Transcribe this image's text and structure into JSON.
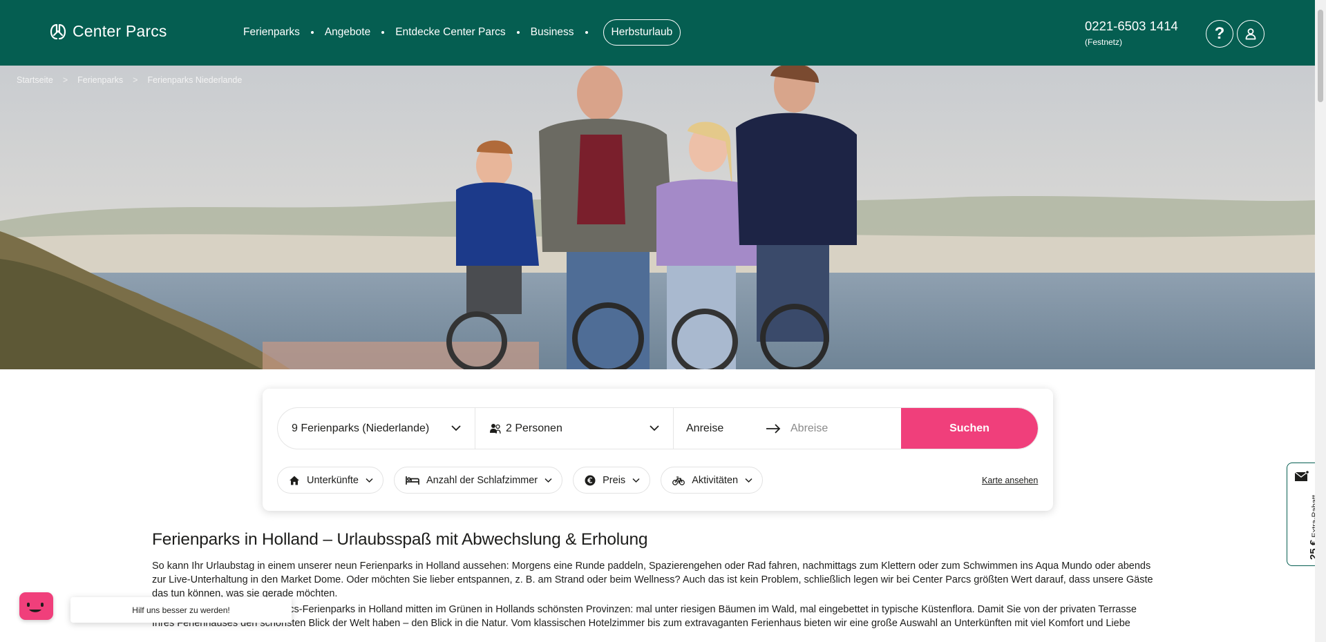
{
  "header": {
    "brand": "Center Parcs",
    "nav": [
      {
        "label": "Ferienparks"
      },
      {
        "label": "Angebote"
      },
      {
        "label": "Entdecke Center Parcs"
      },
      {
        "label": "Business"
      }
    ],
    "highlight_label": "Herbsturlaub",
    "phone": "0221-6503 1414",
    "phone_note": "(Festnetz)",
    "help_label": "?",
    "icons": {
      "help": "question-icon",
      "account": "user-icon"
    }
  },
  "breadcrumb": [
    "Startseite",
    "Ferienparks",
    "Ferienparks Niederlande"
  ],
  "search": {
    "park": "9 Ferienparks (Niederlande)",
    "persons": "2 Personen",
    "arrival": "Anreise",
    "departure": "Abreise",
    "submit": "Suchen"
  },
  "filters": [
    {
      "label": "Unterkünfte",
      "icon": "home-icon"
    },
    {
      "label": "Anzahl der Schlafzimmer",
      "icon": "bed-icon"
    },
    {
      "label": "Preis",
      "icon": "euro-icon"
    },
    {
      "label": "Aktivitäten",
      "icon": "bike-icon"
    }
  ],
  "map_link": "Karte ansehen",
  "content": {
    "title": "Ferienparks in Holland – Urlaubsspaß mit Abwechslung & Erholung",
    "paragraphs": [
      "So kann Ihr Urlaubstag in einem unserer neun Ferienparks in Holland aussehen: Morgens eine Runde paddeln, Spazierengehen oder Rad fahren, nachmittags zum Klettern oder zum Schwimmen ins Aqua Mundo oder abends zur Live-Unterhaltung in den Market Dome. Oder möchten Sie lieber entspannen, z. B. am Strand oder beim Wellness? Auch das ist kein Problem, schließlich legen wir bei Center Parcs größten Wert darauf, dass unsere Gäste das tun können, was sie gerade möchten.",
      "Übrigens liegen die Center Parcs-Ferienparks in Holland mitten im Grünen in Hollands schönsten Provinzen: mal unter riesigen Bäumen im Wald, mal eingebettet in typische Küstenflora. Damit Sie von der privaten Terrasse Ihres Ferienhauses den schönsten Blick der Welt haben – den Blick in die Natur. Vom klassischen Hotelzimmer bis zum extravaganten Ferienhaus bieten wir eine große Auswahl an Unterkünften mit viel Komfort und Liebe"
    ]
  },
  "feedback": {
    "label": "Hilf uns besser zu werden!"
  },
  "discount": {
    "amount": "25 €",
    "label": "Extra-Rabatt"
  },
  "colors": {
    "brand_green": "#055e51",
    "accent_pink": "#f03f7b"
  }
}
